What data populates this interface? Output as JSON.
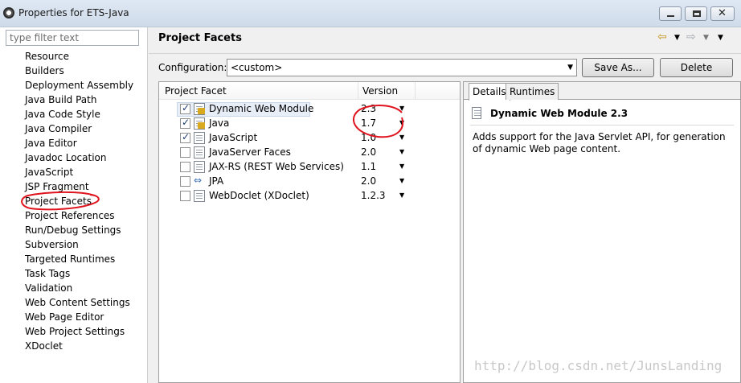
{
  "window": {
    "title": "Properties for ETS-Java"
  },
  "filter": {
    "placeholder": "type filter text"
  },
  "nav": {
    "items": [
      "Resource",
      "Builders",
      "Deployment Assembly",
      "Java Build Path",
      "Java Code Style",
      "Java Compiler",
      "Java Editor",
      "Javadoc Location",
      "JavaScript",
      "JSP Fragment",
      "Project Facets",
      "Project References",
      "Run/Debug Settings",
      "Subversion",
      "Targeted Runtimes",
      "Task Tags",
      "Validation",
      "Web Content Settings",
      "Web Page Editor",
      "Web Project Settings",
      "XDoclet"
    ],
    "selected": "Project Facets"
  },
  "page": {
    "title": "Project Facets"
  },
  "config": {
    "label": "Configuration:",
    "value": "<custom>",
    "save_as_label": "Save As...",
    "delete_label": "Delete"
  },
  "facets": {
    "col_facet": "Project Facet",
    "col_version": "Version",
    "rows": [
      {
        "name": "Dynamic Web Module",
        "version": "2.3",
        "checked": true,
        "icon": "web-module-icon",
        "locked": true
      },
      {
        "name": "Java",
        "version": "1.7",
        "checked": true,
        "icon": "java-icon",
        "locked": true
      },
      {
        "name": "JavaScript",
        "version": "1.0",
        "checked": true,
        "icon": "document-icon",
        "locked": false
      },
      {
        "name": "JavaServer Faces",
        "version": "2.0",
        "checked": false,
        "icon": "document-icon",
        "locked": false
      },
      {
        "name": "JAX-RS (REST Web Services)",
        "version": "1.1",
        "checked": false,
        "icon": "document-icon",
        "locked": false
      },
      {
        "name": "JPA",
        "version": "2.0",
        "checked": false,
        "icon": "jpa-icon",
        "locked": false
      },
      {
        "name": "WebDoclet (XDoclet)",
        "version": "1.2.3",
        "checked": false,
        "icon": "document-icon",
        "locked": false
      }
    ]
  },
  "details": {
    "tab_details": "Details",
    "tab_runtimes": "Runtimes",
    "title": "Dynamic Web Module 2.3",
    "description": "Adds support for the Java Servlet API, for generation of dynamic Web page content."
  },
  "watermark": "http://blog.csdn.net/JunsLanding",
  "colors": {
    "annotation": "#e0141e",
    "selection": "#e8eef7",
    "titlebar": "#dfe8f3"
  }
}
